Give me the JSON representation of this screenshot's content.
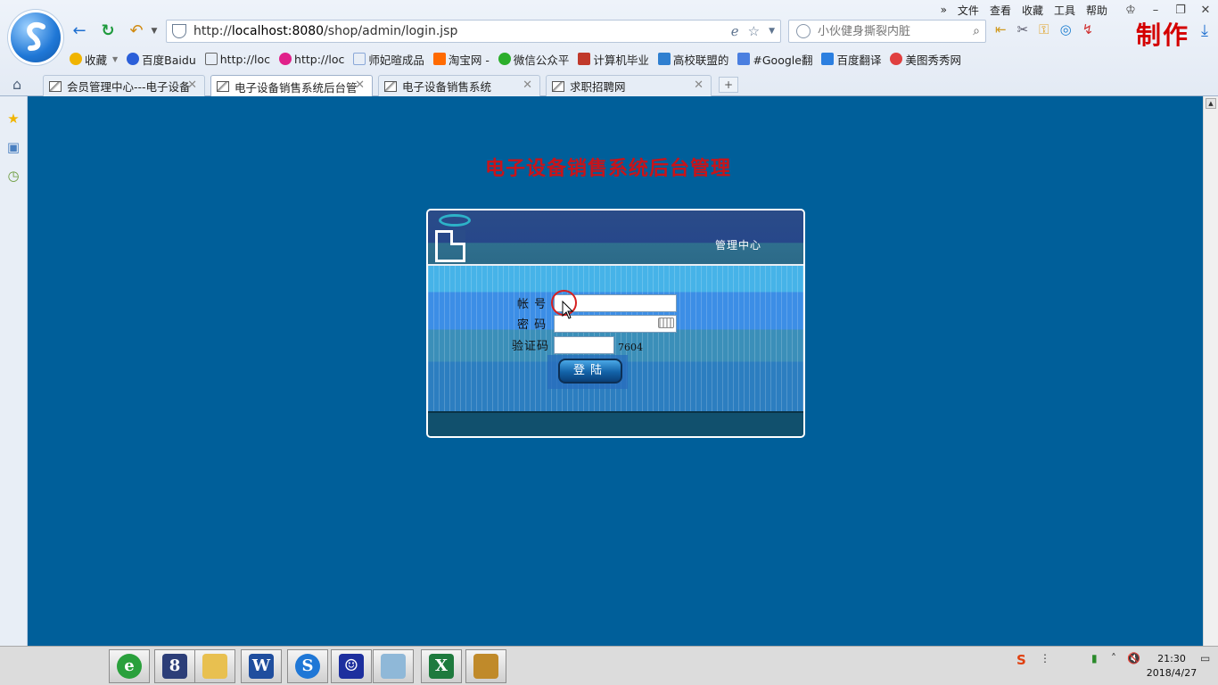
{
  "browser": {
    "menu": [
      "文件",
      "查看",
      "收藏",
      "工具",
      "帮助"
    ],
    "brand": "制作",
    "address": {
      "prefix": "http://",
      "host": "localhost:8080",
      "path": "/shop/admin/login.jsp"
    },
    "search_placeholder": "小伙健身撕裂内脏",
    "bookmarks": [
      {
        "label": "收藏",
        "color": "#f0b400"
      },
      {
        "label": "百度Baidu",
        "color": "#2b5fd9"
      },
      {
        "label": "http://loc",
        "color": "#666666"
      },
      {
        "label": "http://loc",
        "color": "#e0218a"
      },
      {
        "label": "师妃暄成品",
        "color": "#8aa8d8"
      },
      {
        "label": "淘宝网 -",
        "color": "#ff6a00"
      },
      {
        "label": "微信公众平",
        "color": "#2bae2b"
      },
      {
        "label": "计算机毕业",
        "color": "#c0392b"
      },
      {
        "label": "高校联盟的",
        "color": "#2f7fd0"
      },
      {
        "label": "#Google翻",
        "color": "#4a7fe0"
      },
      {
        "label": "百度翻译",
        "color": "#2b7fe0"
      },
      {
        "label": "美图秀秀网",
        "color": "#e04040"
      }
    ],
    "tabs": [
      {
        "title": "会员管理中心---电子设备",
        "active": false
      },
      {
        "title": "电子设备销售系统后台管",
        "active": true
      },
      {
        "title": "电子设备销售系统",
        "active": false
      },
      {
        "title": "求职招聘网",
        "active": false
      }
    ],
    "new_tab": "+"
  },
  "page": {
    "title": "电子设备销售系统后台管理",
    "header_text": "管理中心",
    "form": {
      "account_label": "帐  号",
      "password_label": "密  码",
      "captcha_label": "验证码",
      "captcha_code": "7604",
      "account_value": "",
      "password_value": "",
      "captcha_value": "",
      "login_button": "登陆"
    }
  },
  "taskbar": {
    "apps": [
      {
        "name": "ie-icon",
        "glyph": "e",
        "color": "#2aa03c"
      },
      {
        "name": "eclipse-icon",
        "glyph": "8",
        "color": "#2c3e78"
      },
      {
        "name": "folder-icon",
        "glyph": "",
        "color": "#e8c050"
      },
      {
        "name": "word-icon",
        "glyph": "W",
        "color": "#1f4e9e"
      },
      {
        "name": "sogou-browser-icon",
        "glyph": "S",
        "color": "#1f77d6"
      },
      {
        "name": "portrait-app-icon",
        "glyph": "☺",
        "color": "#1d2f9e"
      },
      {
        "name": "notepad-icon",
        "glyph": "",
        "color": "#8fb8d8"
      },
      {
        "name": "excel-icon",
        "glyph": "X",
        "color": "#1e7a3e"
      },
      {
        "name": "winrar-icon",
        "glyph": "",
        "color": "#c08a2a"
      }
    ],
    "time": "21:30",
    "date": "2018/4/27"
  }
}
